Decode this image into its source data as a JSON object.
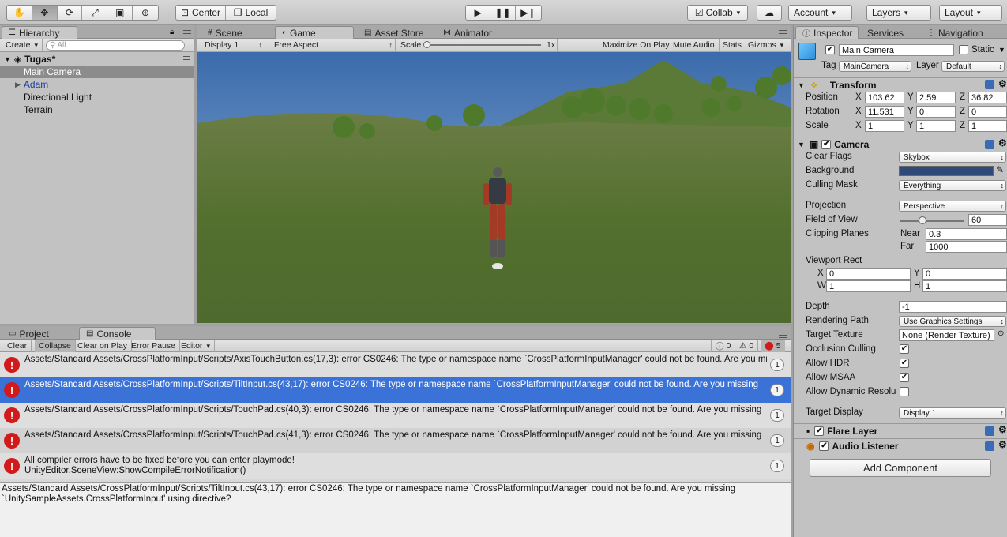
{
  "toolbar": {
    "pivot_label": "Center",
    "space_label": "Local",
    "collab_label": "Collab",
    "account_label": "Account",
    "layers_label": "Layers",
    "layout_label": "Layout"
  },
  "hierarchy": {
    "tab": "Hierarchy",
    "create_label": "Create",
    "search_placeholder": "All",
    "scene_name": "Tugas*",
    "items": [
      {
        "label": "Main Camera",
        "selected": true
      },
      {
        "label": "Adam",
        "prefab": true
      },
      {
        "label": "Directional Light"
      },
      {
        "label": "Terrain"
      }
    ]
  },
  "center_tabs": {
    "scene": "Scene",
    "game": "Game",
    "asset_store": "Asset Store",
    "animator": "Animator"
  },
  "game_bar": {
    "display": "Display 1",
    "aspect": "Free Aspect",
    "scale_label": "Scale",
    "scale_value": "1x",
    "maximize": "Maximize On Play",
    "mute": "Mute Audio",
    "stats": "Stats",
    "gizmos": "Gizmos"
  },
  "bottom_tabs": {
    "project": "Project",
    "console": "Console"
  },
  "console_bar": {
    "clear": "Clear",
    "collapse": "Collapse",
    "clear_on_play": "Clear on Play",
    "error_pause": "Error Pause",
    "editor": "Editor",
    "log_count": "0",
    "warn_count": "0",
    "error_count": "5"
  },
  "console": {
    "entries": [
      {
        "text": "Assets/Standard Assets/CrossPlatformInput/Scripts/AxisTouchButton.cs(17,3): error CS0246: The type or namespace name `CrossPlatformInputManager' could not be found. Are you missing",
        "count": "1"
      },
      {
        "text": "Assets/Standard Assets/CrossPlatformInput/Scripts/TiltInput.cs(43,17): error CS0246: The type or namespace name `CrossPlatformInputManager' could not be found. Are you missing",
        "count": "1",
        "selected": true
      },
      {
        "text": "Assets/Standard Assets/CrossPlatformInput/Scripts/TouchPad.cs(40,3): error CS0246: The type or namespace name `CrossPlatformInputManager' could not be found. Are you missing",
        "count": "1"
      },
      {
        "text": "Assets/Standard Assets/CrossPlatformInput/Scripts/TouchPad.cs(41,3): error CS0246: The type or namespace name `CrossPlatformInputManager' could not be found. Are you missing",
        "count": "1"
      },
      {
        "text": "All compiler errors have to be fixed before you can enter playmode!",
        "text2": "UnityEditor.SceneView:ShowCompileErrorNotification()",
        "count": "1"
      }
    ],
    "detail_line1": "Assets/Standard Assets/CrossPlatformInput/Scripts/TiltInput.cs(43,17): error CS0246: The type or namespace name `CrossPlatformInputManager' could not be found. Are you missing",
    "detail_line2": "`UnitySampleAssets.CrossPlatformInput' using directive?"
  },
  "inspector_tabs": {
    "inspector": "Inspector",
    "services": "Services",
    "navigation": "Navigation"
  },
  "inspector": {
    "object_name": "Main Camera",
    "static_label": "Static",
    "tag_label": "Tag",
    "tag_value": "MainCamera",
    "layer_label": "Layer",
    "layer_value": "Default",
    "transform": {
      "title": "Transform",
      "position_label": "Position",
      "rotation_label": "Rotation",
      "scale_label": "Scale",
      "position": {
        "x": "103.62",
        "y": "2.59",
        "z": "36.82"
      },
      "rotation": {
        "x": "11.531",
        "y": "0",
        "z": "0"
      },
      "scale": {
        "x": "1",
        "y": "1",
        "z": "1"
      }
    },
    "camera": {
      "title": "Camera",
      "clear_flags_label": "Clear Flags",
      "clear_flags": "Skybox",
      "background_label": "Background",
      "background_color": "#2f4a78",
      "culling_mask_label": "Culling Mask",
      "culling_mask": "Everything",
      "projection_label": "Projection",
      "projection": "Perspective",
      "fov_label": "Field of View",
      "fov": "60",
      "fov_fraction": 0.33,
      "clipping_label": "Clipping Planes",
      "near_label": "Near",
      "near": "0.3",
      "far_label": "Far",
      "far": "1000",
      "viewport_label": "Viewport Rect",
      "vx": "0",
      "vy": "0",
      "vw": "1",
      "vh": "1",
      "depth_label": "Depth",
      "depth": "-1",
      "rendering_path_label": "Rendering Path",
      "rendering_path": "Use Graphics Settings",
      "target_texture_label": "Target Texture",
      "target_texture": "None (Render Texture)",
      "occlusion_label": "Occlusion Culling",
      "hdr_label": "Allow HDR",
      "msaa_label": "Allow MSAA",
      "dynres_label": "Allow Dynamic Resolu",
      "target_display_label": "Target Display",
      "target_display": "Display 1"
    },
    "flare_layer": "Flare Layer",
    "audio_listener": "Audio Listener",
    "add_component": "Add Component"
  }
}
